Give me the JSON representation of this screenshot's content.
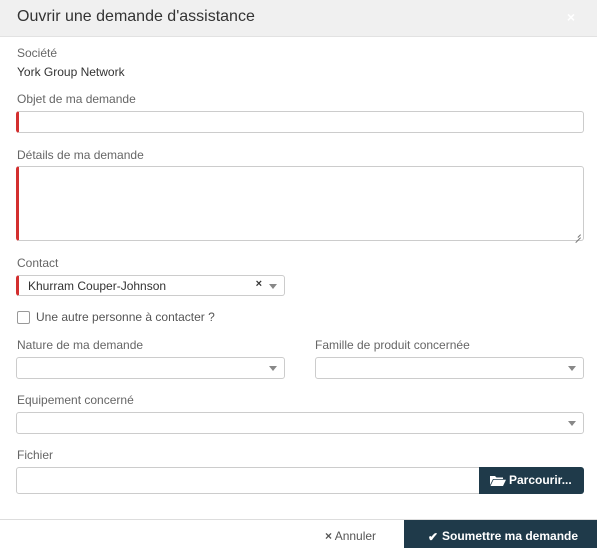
{
  "dialog": {
    "title": "Ouvrir une demande d'assistance",
    "close_glyph": "×"
  },
  "form": {
    "company_label": "Société",
    "company_value": "York Group Network",
    "subject_label": "Objet de ma demande",
    "subject_value": "",
    "details_label": "Détails de ma demande",
    "details_value": "",
    "contact_label": "Contact",
    "contact_value": "Khurram Couper-Johnson",
    "contact_clear": "×",
    "other_contact_label": "Une autre personne à contacter ?",
    "other_contact_checked": false,
    "nature_label": "Nature de ma demande",
    "nature_value": "",
    "family_label": "Famille de produit concernée",
    "family_value": "",
    "equipment_label": "Equipement concerné",
    "equipment_value": "",
    "file_label": "Fichier",
    "file_value": "",
    "browse_label": "Parcourir..."
  },
  "footer": {
    "cancel_label": "Annuler",
    "cancel_icon": "×",
    "submit_label": "Soumettre ma demande",
    "submit_icon": "✔"
  },
  "colors": {
    "accent_dark": "#1f3a4a",
    "required_marker": "#d32f2f",
    "header_bg": "#f0f0f0"
  },
  "icons": {
    "close": "close-icon",
    "resize": "resize-handle-icon",
    "caret": "chevron-down-icon",
    "folder": "folder-open-icon",
    "cancel": "times-icon",
    "submit": "check-icon"
  }
}
